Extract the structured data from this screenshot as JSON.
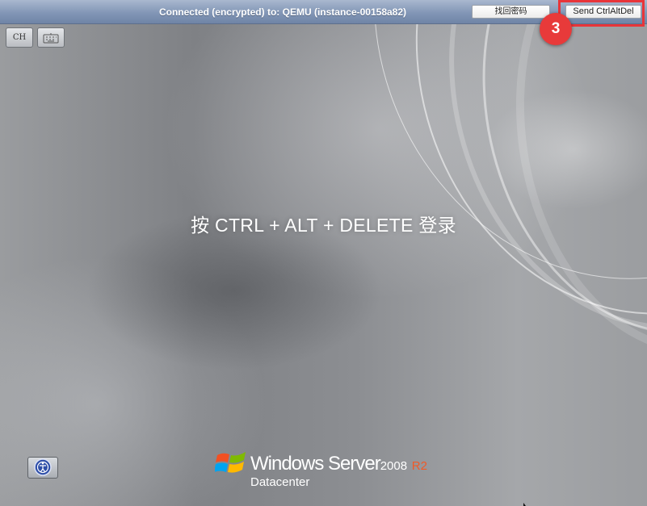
{
  "window": {
    "connection_title": "Connected (encrypted) to: QEMU (instance-00158a82)"
  },
  "toolbar": {
    "recover_password_label": "找回密码",
    "send_ctrl_alt_del_label": "Send CtrlAltDel"
  },
  "annotation": {
    "step_number": "3",
    "color": "#e8353a"
  },
  "side_controls": {
    "ime_label": "CH",
    "keyboard_icon": "keyboard-icon",
    "accessibility_icon": "ease-of-access-icon"
  },
  "desktop": {
    "login_prompt": "按 CTRL + ALT + DELETE 登录"
  },
  "branding": {
    "product": "Windows Server",
    "version": "2008",
    "release": "R2",
    "edition": "Datacenter",
    "logo_icon": "windows-flag-icon",
    "accent": "#f05a28"
  }
}
